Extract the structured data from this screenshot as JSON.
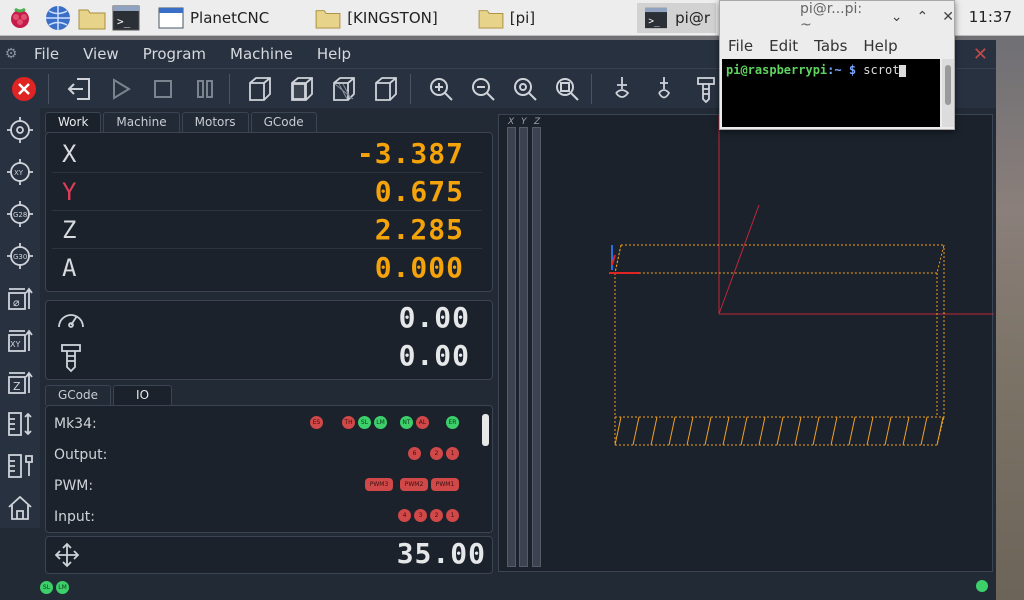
{
  "taskbar": {
    "apps": [
      {
        "label": "PlanetCNC"
      },
      {
        "label": "[KINGSTON]"
      },
      {
        "label": "[pi]"
      },
      {
        "label": "pi@r"
      }
    ],
    "clock": "11:37"
  },
  "menubar": {
    "items": [
      "File",
      "View",
      "Program",
      "Machine",
      "Help"
    ]
  },
  "work_tabs": [
    "Work",
    "Machine",
    "Motors",
    "GCode"
  ],
  "axes": [
    {
      "name": "X",
      "value": "-3.387"
    },
    {
      "name": "Y",
      "value": "0.675"
    },
    {
      "name": "Z",
      "value": "2.285"
    },
    {
      "name": "A",
      "value": "0.000"
    }
  ],
  "feed": {
    "speed": "0.00",
    "spindle": "0.00"
  },
  "io_tabs": [
    "GCode",
    "IO"
  ],
  "io_rows": [
    {
      "label": "Mk34:",
      "leds": [
        {
          "text": "ES",
          "color": "red"
        },
        {
          "text": "TH",
          "color": "red"
        },
        {
          "text": "SL",
          "color": "green"
        },
        {
          "text": "LM",
          "color": "green"
        },
        {
          "text": "NT",
          "color": "green"
        },
        {
          "text": "AL",
          "color": "red"
        },
        {
          "text": "ER",
          "color": "green"
        }
      ]
    },
    {
      "label": "Output:",
      "leds": [
        {
          "text": "6",
          "color": "red"
        },
        {
          "text": "2",
          "color": "red"
        },
        {
          "text": "1",
          "color": "red"
        }
      ]
    },
    {
      "label": "PWM:",
      "leds": [
        {
          "text": "PWM3",
          "color": "red",
          "pill": true
        },
        {
          "text": "PWM2",
          "color": "red",
          "pill": true
        },
        {
          "text": "PWM1",
          "color": "red",
          "pill": true
        }
      ]
    },
    {
      "label": "Input:",
      "leds": [
        {
          "text": "4",
          "color": "red"
        },
        {
          "text": "3",
          "color": "red"
        },
        {
          "text": "2",
          "color": "red"
        },
        {
          "text": "1",
          "color": "red"
        }
      ]
    }
  ],
  "jog": {
    "value": "35.00"
  },
  "viewport": {
    "bars": [
      "X",
      "Y",
      "Z"
    ]
  },
  "terminal": {
    "title": "pi@r...pi: ~",
    "menu": [
      "File",
      "Edit",
      "Tabs",
      "Help"
    ],
    "prompt_user": "pi@raspberrypi",
    "prompt_path": ":~ $",
    "command": "scrot"
  },
  "statusbar": {
    "leds": [
      {
        "text": "SL",
        "color": "green"
      },
      {
        "text": "LM",
        "color": "green"
      }
    ]
  },
  "colors": {
    "accent": "#f5a30a",
    "y_axis": "#e23b57",
    "red_led": "#d04848",
    "green_led": "#3ccf6a"
  }
}
